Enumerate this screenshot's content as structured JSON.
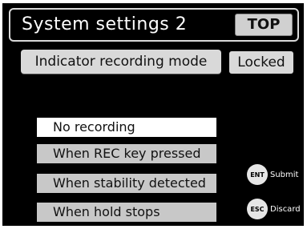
{
  "header": {
    "title": "System settings 2",
    "top_label": "TOP"
  },
  "setting": {
    "label": "Indicator recording mode",
    "status": "Locked"
  },
  "options": [
    {
      "label": "No recording",
      "selected": true
    },
    {
      "label": "When REC key pressed",
      "selected": false
    },
    {
      "label": "When stability detected",
      "selected": false
    },
    {
      "label": "When hold stops",
      "selected": false
    }
  ],
  "keys": {
    "ent": {
      "key": "ENT",
      "label": "Submit"
    },
    "esc": {
      "key": "ESC",
      "label": "Discard"
    }
  },
  "colors": {
    "background": "#000000",
    "selected_option": "#ffffff",
    "option": "#c8c8c8",
    "button": "#d9d9d9"
  }
}
